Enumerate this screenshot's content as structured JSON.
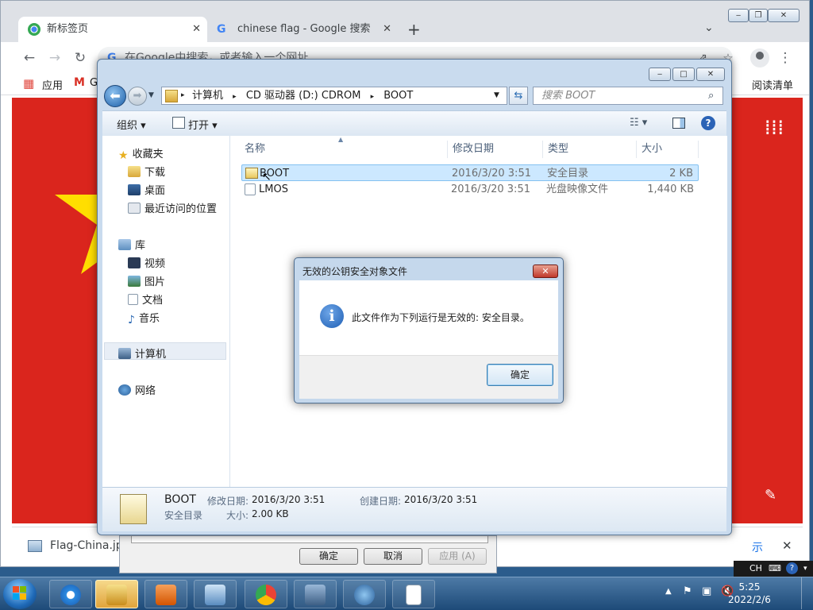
{
  "chrome": {
    "tabs": [
      {
        "label": "新标签页",
        "close": "✕"
      },
      {
        "label": "chinese flag - Google 搜索",
        "close": "✕"
      }
    ],
    "new_tab": "+",
    "omnibox_placeholder": "在Google中搜索，或者输入一个网址",
    "bookmarks": {
      "apps": "应用",
      "gmail": "G",
      "reading_list": "阅读清单"
    },
    "download_item": "Flag-China.jpg",
    "download_show_all": "示",
    "download_close": "✕"
  },
  "explorer": {
    "breadcrumb": [
      "计算机",
      "CD 驱动器 (D:) CDROM",
      "BOOT"
    ],
    "search_placeholder": "搜索 BOOT",
    "toolbar": {
      "organize": "组织",
      "open": "打开"
    },
    "nav": {
      "favorites": "收藏夹",
      "downloads": "下载",
      "desktop": "桌面",
      "recent": "最近访问的位置",
      "libraries": "库",
      "videos": "视频",
      "pictures": "图片",
      "documents": "文档",
      "music": "音乐",
      "computer": "计算机",
      "network": "网络"
    },
    "columns": {
      "name": "名称",
      "modified": "修改日期",
      "type": "类型",
      "size": "大小"
    },
    "files": [
      {
        "name": "BOOT",
        "modified": "2016/3/20 3:51",
        "type": "安全目录",
        "size": "2 KB"
      },
      {
        "name": "LMOS",
        "modified": "2016/3/20 3:51",
        "type": "光盘映像文件",
        "size": "1,440 KB"
      }
    ],
    "details": {
      "name": "BOOT",
      "type": "安全目录",
      "modified_label": "修改日期:",
      "modified_value": "2016/3/20 3:51",
      "created_label": "创建日期:",
      "created_value": "2016/3/20 3:51",
      "size_label": "大小:",
      "size_value": "2.00 KB"
    }
  },
  "dialog": {
    "title": "无效的公钥安全对象文件",
    "message": "此文件作为下列运行是无效的: 安全目录。",
    "ok": "确定"
  },
  "back_dialog": {
    "ok": "确定",
    "cancel": "取消",
    "apply": "应用 (A)"
  },
  "taskbar": {
    "time": "5:25",
    "date": "2022/2/6",
    "ime": "CH"
  },
  "colors": {
    "flag_red": "#da251d",
    "flag_star": "#ffde00",
    "selection": "#cce8ff",
    "info_blue": "#1f5fb4"
  }
}
